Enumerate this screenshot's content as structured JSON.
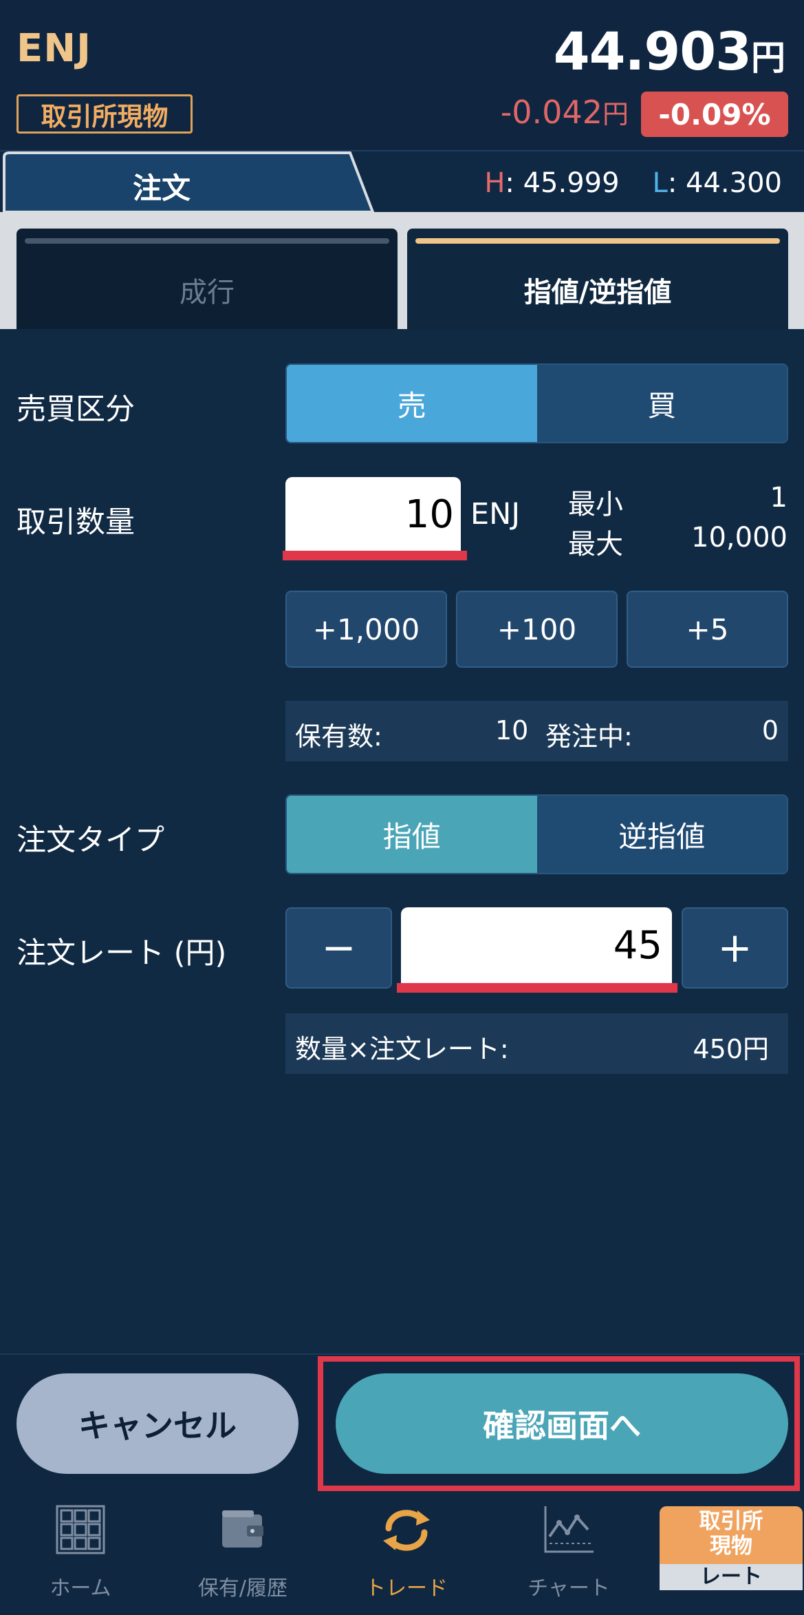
{
  "header": {
    "symbol": "ENJ",
    "market_badge": "取引所現物",
    "price": "44.903",
    "price_unit": "円",
    "change": "-0.042",
    "change_unit": "円",
    "change_pct": "-0.09%",
    "high_label": "H",
    "high_value": ": 45.999",
    "low_label": "L",
    "low_value": ": 44.300"
  },
  "tabs": {
    "order": "注文"
  },
  "order_types": {
    "market": "成行",
    "limit": "指値/逆指値"
  },
  "form": {
    "side_label": "売買区分",
    "side_sell": "売",
    "side_buy": "買",
    "qty_label": "取引数量",
    "qty_value": "10",
    "qty_unit": "ENJ",
    "min_label": "最小",
    "min_value": "1",
    "max_label": "最大",
    "max_value": "10,000",
    "quick_add": [
      "+1,000",
      "+100",
      "+5"
    ],
    "holding_label": "保有数:",
    "holding_value": "10",
    "pending_label": "発注中:",
    "pending_value": "0",
    "type_label": "注文タイプ",
    "type_limit": "指値",
    "type_stop": "逆指値",
    "rate_label": "注文レート (円)",
    "rate_minus": "−",
    "rate_value": "45",
    "rate_plus": "+",
    "calc_label": "数量×注文レート:",
    "calc_value": "450円"
  },
  "actions": {
    "cancel": "キャンセル",
    "confirm": "確認画面へ"
  },
  "nav": {
    "home": "ホーム",
    "holdings": "保有/履歴",
    "trade": "トレード",
    "chart": "チャート",
    "rate_top_1": "取引所",
    "rate_top_2": "現物",
    "rate_bottom": "レート"
  },
  "colors": {
    "background": "#112a44",
    "accent_sell": "#4aa7da",
    "accent_teal": "#4aa5b7",
    "negative": "#d95252",
    "highlight": "#e0384b",
    "badge": "#f2ad62"
  }
}
